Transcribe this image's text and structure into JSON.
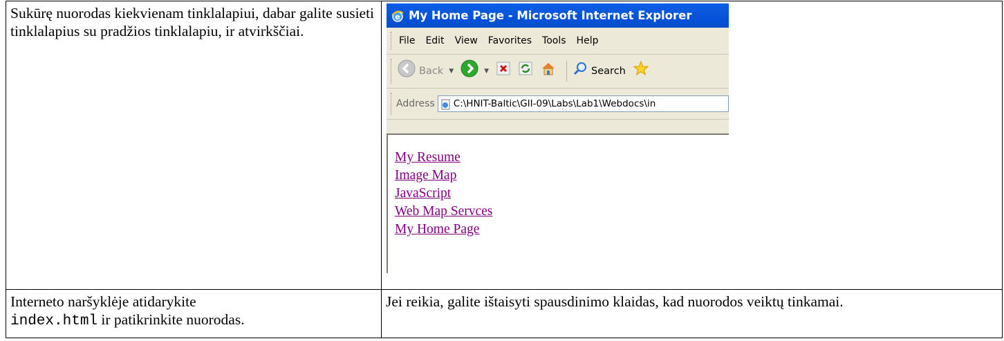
{
  "rows": [
    {
      "left_text": "Sukūrę nuorodas kiekvienam tinklalapiui, dabar galite susieti tinklalapius su pradžios tinklalapiu, ir atvirkščiai.",
      "browser": {
        "title": "My Home Page - Microsoft Internet Explorer",
        "menu": [
          "File",
          "Edit",
          "View",
          "Favorites",
          "Tools",
          "Help"
        ],
        "toolbar": {
          "back": "Back",
          "search": "Search"
        },
        "address_label": "Address",
        "address_value": "C:\\HNIT-Baltic\\GII-09\\Labs\\Lab1\\Webdocs\\in",
        "links": [
          "My Resume",
          "Image Map",
          "JavaScript",
          "Web Map Servces",
          "My Home Page"
        ],
        "link_color": "#800080",
        "title_bar_color": "#0a5ee8"
      }
    },
    {
      "left_text_before": "Interneto naršyklėje atidarykite",
      "left_code": "index.html",
      "left_text_after": "ir patikrinkite nuorodas.",
      "right_text": "Jei reikia, galite ištaisyti spausdinimo klaidas, kad nuorodos veiktų tinkamai."
    }
  ]
}
